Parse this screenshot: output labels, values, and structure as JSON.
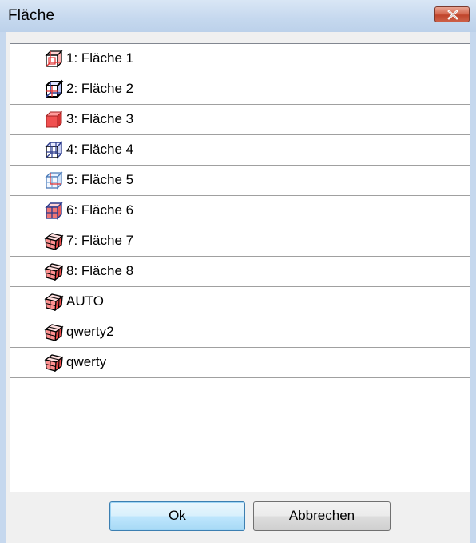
{
  "window": {
    "title": "Fläche"
  },
  "list": {
    "items": [
      {
        "label": "1: Fläche 1",
        "icon": "cube-wireframe-red-icon"
      },
      {
        "label": "2: Fläche 2",
        "icon": "cube-wireframe-bold-icon"
      },
      {
        "label": "3: Fläche 3",
        "icon": "cube-solid-red-icon"
      },
      {
        "label": "4: Fläche 4",
        "icon": "cube-wireframe-blue-icon"
      },
      {
        "label": "5: Fläche 5",
        "icon": "cube-wireframe-lightblue-icon"
      },
      {
        "label": "6: Fläche 6",
        "icon": "cube-wireframe-red-blue-icon"
      },
      {
        "label": "7: Fläche 7",
        "icon": "cube-shaded-red-icon"
      },
      {
        "label": "8: Fläche 8",
        "icon": "cube-shaded-red-icon"
      },
      {
        "label": "AUTO",
        "icon": "cube-shaded-red-icon"
      },
      {
        "label": "qwerty2",
        "icon": "cube-shaded-red-icon"
      },
      {
        "label": "qwerty",
        "icon": "cube-shaded-red-icon"
      }
    ]
  },
  "buttons": {
    "ok_label": "Ok",
    "cancel_label": "Abbrechen"
  },
  "colors": {
    "title_bar": "#c6d8ee",
    "close_button": "#c0452c",
    "icon_red": "#e03030",
    "icon_blue": "#2a3a8c",
    "icon_lightblue": "#7aa8d8"
  }
}
